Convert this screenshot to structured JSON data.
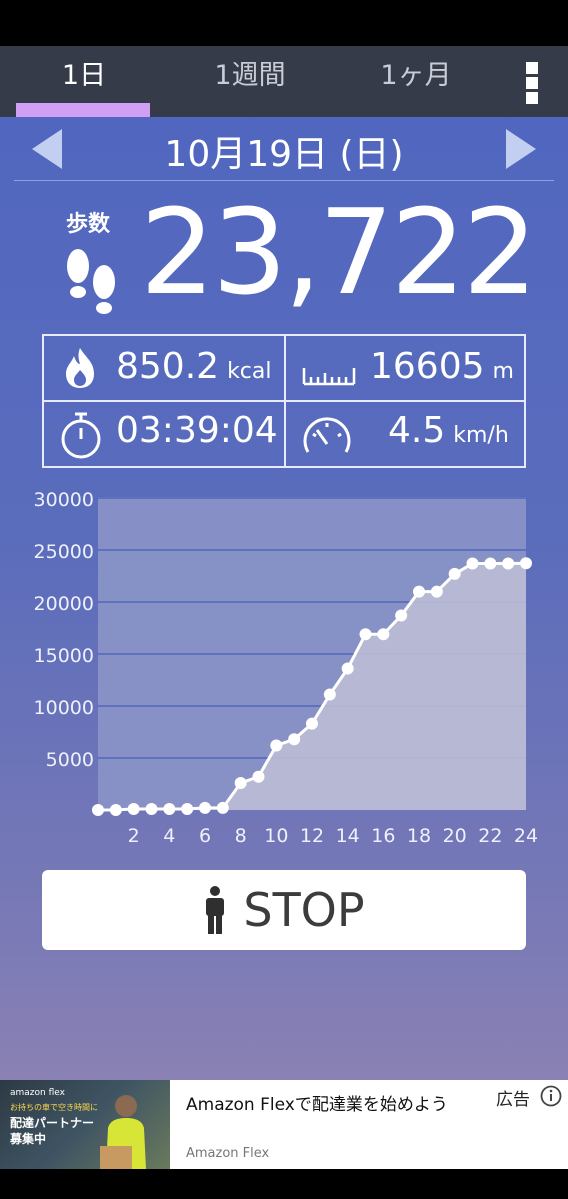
{
  "tabs": [
    {
      "label": "1日",
      "active": true
    },
    {
      "label": "1週間",
      "active": false
    },
    {
      "label": "1ヶ月",
      "active": false
    }
  ],
  "menu_icon": "more-vertical-icon",
  "date": {
    "label": "10月19日 (日)",
    "prev_icon": "left-arrow-icon",
    "next_icon": "right-arrow-icon"
  },
  "steps": {
    "label": "歩数",
    "value": "23,722",
    "icon": "footprints-icon"
  },
  "stats": {
    "calories": {
      "value": "850.2",
      "unit": "kcal",
      "icon": "fire-icon"
    },
    "distance": {
      "value": "16605",
      "unit": "m",
      "icon": "ruler-icon"
    },
    "time": {
      "value": "03:39:04",
      "icon": "stopwatch-icon"
    },
    "speed": {
      "value": "4.5",
      "unit": "km/h",
      "icon": "speedometer-icon"
    }
  },
  "chart_data": {
    "type": "line",
    "x": [
      0,
      1,
      2,
      3,
      4,
      5,
      6,
      7,
      8,
      9,
      10,
      11,
      12,
      13,
      14,
      15,
      16,
      17,
      18,
      19,
      20,
      21,
      22,
      23,
      24
    ],
    "values": [
      0,
      0,
      100,
      100,
      100,
      100,
      200,
      200,
      2600,
      3200,
      6200,
      6800,
      8300,
      11100,
      13600,
      16900,
      16900,
      18700,
      21000,
      21000,
      22700,
      23700,
      23700,
      23700,
      23722
    ],
    "x_ticks": [
      "2",
      "4",
      "6",
      "8",
      "10",
      "12",
      "14",
      "16",
      "18",
      "20",
      "22",
      "24"
    ],
    "y_ticks": [
      "5000",
      "10000",
      "15000",
      "20000",
      "25000",
      "30000"
    ],
    "xlim": [
      0,
      24
    ],
    "ylim": [
      0,
      30000
    ],
    "grid": true,
    "area_fill": true,
    "colors": {
      "line": "#ffffff",
      "fill": "#bfc0d6",
      "plot_bg": "#8b95c6",
      "grid": "#5e70c0"
    }
  },
  "stop_button": {
    "label": "STOP",
    "icon": "person-icon"
  },
  "ad": {
    "image_brand": "amazon flex",
    "image_line1": "お持ちの車で空き時間に",
    "image_line2": "配達パートナー",
    "image_line3": "募集中",
    "title": "Amazon Flexで配達業を始めよう",
    "source": "Amazon Flex",
    "badge": "広告",
    "info_icon": "info-icon"
  }
}
